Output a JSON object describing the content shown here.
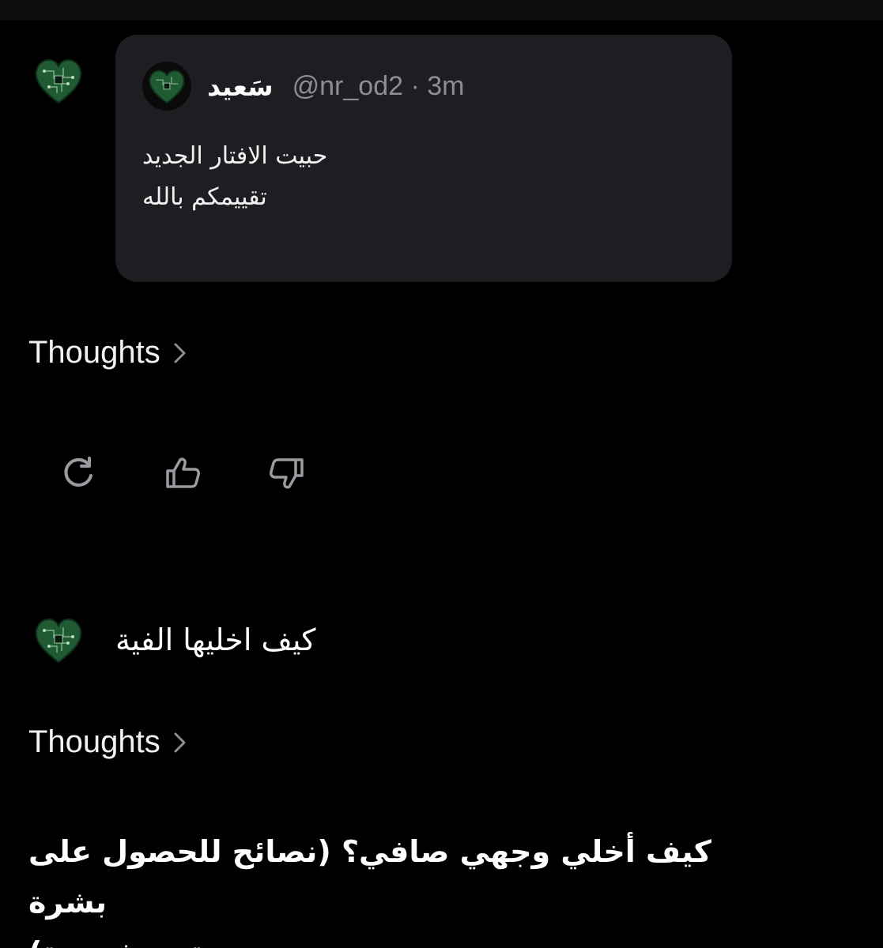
{
  "quoted_post": {
    "author_name": "سَعيد",
    "handle_time": "@nr_od2 · 3m",
    "lines": [
      "حبيت الافتار الجديد",
      "تقييمكم بالله"
    ]
  },
  "thoughts_1": {
    "label": "Thoughts"
  },
  "actions": {
    "regenerate": "refresh-icon",
    "like": "thumbs-up-icon",
    "dislike": "thumbs-down-icon"
  },
  "user_message": {
    "text": "كيف اخليها الفية"
  },
  "thoughts_2": {
    "label": "Thoughts"
  },
  "answer": {
    "heading_lines": [
      "كيف أخلي وجهي صافي؟ (نصائح للحصول على بشرة",
      "نضرة ومشدودة)"
    ]
  },
  "colors": {
    "background": "#000000",
    "card": "#1e1e22",
    "muted": "#8d8d93",
    "avatar_green": "#1f5a32"
  }
}
